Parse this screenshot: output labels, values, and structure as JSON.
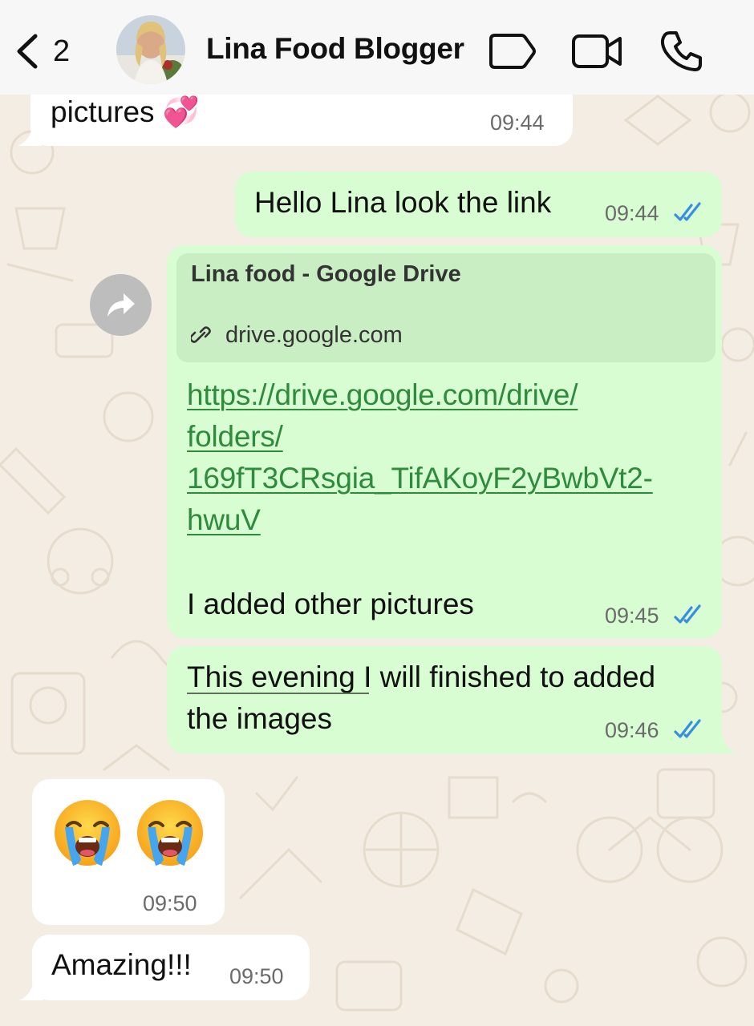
{
  "header": {
    "back_count": "2",
    "contact_name": "Lina Food Blogger"
  },
  "messages": [
    {
      "id": "m1",
      "dir": "in",
      "text": "pictures 💞",
      "time": "09:44"
    },
    {
      "id": "m2",
      "dir": "out",
      "text": "Hello Lina look the link",
      "time": "09:44",
      "read": true
    },
    {
      "id": "m3",
      "dir": "out",
      "preview": {
        "title": "Lina food - Google Drive",
        "domain": "drive.google.com"
      },
      "link_lines": [
        "https://drive.google.com/drive/",
        "folders/",
        "169fT3CRsgia_TifAKoyF2yBwbVt2-",
        "hwuV"
      ],
      "text": "I added other pictures",
      "time": "09:45",
      "read": true
    },
    {
      "id": "m4",
      "dir": "out",
      "lines": [
        "This evening I will finished to added",
        "the images"
      ],
      "time": "09:46",
      "read": true
    },
    {
      "id": "m5",
      "dir": "in",
      "emoji": "😭 😭",
      "time": "09:50"
    },
    {
      "id": "m6",
      "dir": "in",
      "text": "Amazing!!!",
      "time": "09:50"
    }
  ],
  "colors": {
    "incoming": "#ffffff",
    "outgoing": "#d8fdd2",
    "link": "#2e8b3c",
    "read_tick": "#3a8de0",
    "wallpaper": "#f3ede4"
  }
}
